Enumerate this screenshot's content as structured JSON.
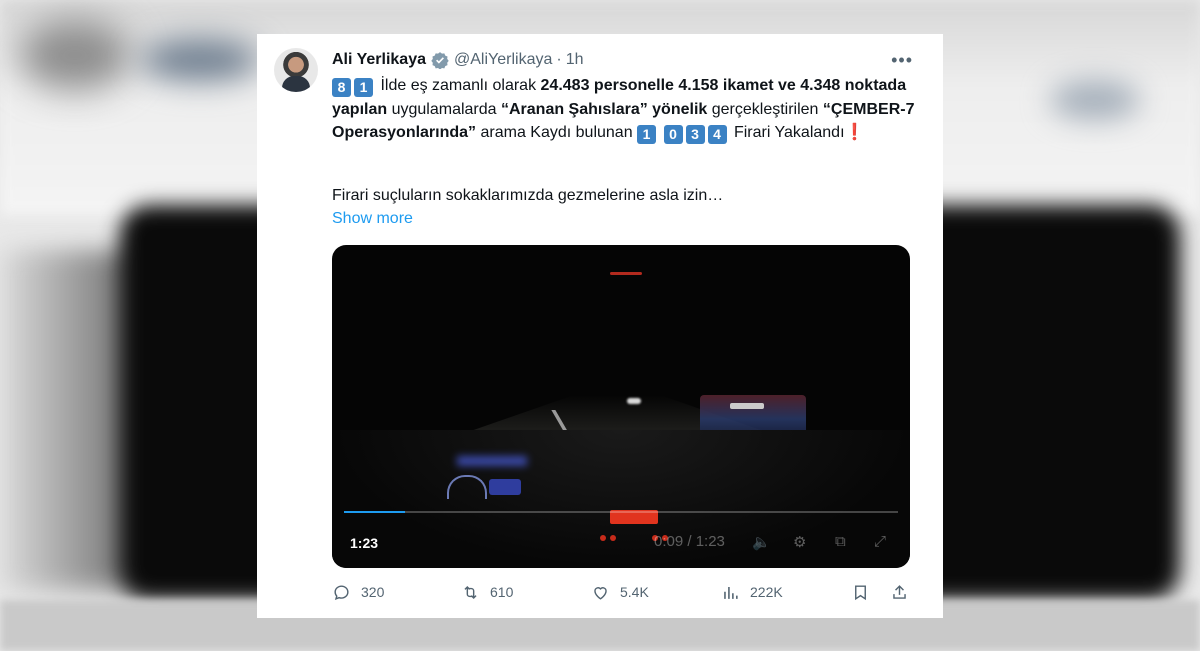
{
  "tweet": {
    "author_name": "Ali Yerlikaya",
    "handle": "@AliYerlikaya",
    "separator": "·",
    "time": "1h",
    "more_icon": "more-horizontal-icon",
    "text": {
      "kc1": "8",
      "kc2": "1",
      "t1": " İlde eş zamanlı olarak ",
      "b1": "24.483 personelle 4.158 ikamet ve 4.348 noktada yapılan",
      "t2": " uygulamalarda ",
      "b2": "“Aranan Şahıslara” yönelik",
      "t3": " gerçekleştirilen ",
      "b3": "“ÇEMBER-7 Operasyonlarında”",
      "t4": " arama Kaydı bulunan ",
      "kc3": "1",
      "kc4": "0",
      "kc5": "3",
      "kc6": "4",
      "t5": " Firari Yakalandı",
      "excl": "❗",
      "para2": "Firari suçluların sokaklarımızda gezmelerine asla izin…"
    },
    "show_more": "Show more"
  },
  "video": {
    "duration_badge": "1:23",
    "time_display": "0:09 / 1:23",
    "progress": 0.11
  },
  "actions": {
    "replies": "320",
    "reposts": "610",
    "likes": "5.4K",
    "views": "222K"
  },
  "colors": {
    "accent": "#1d9bf0",
    "text": "#0f1419",
    "muted": "#536471",
    "keycap": "#3b82c4"
  }
}
